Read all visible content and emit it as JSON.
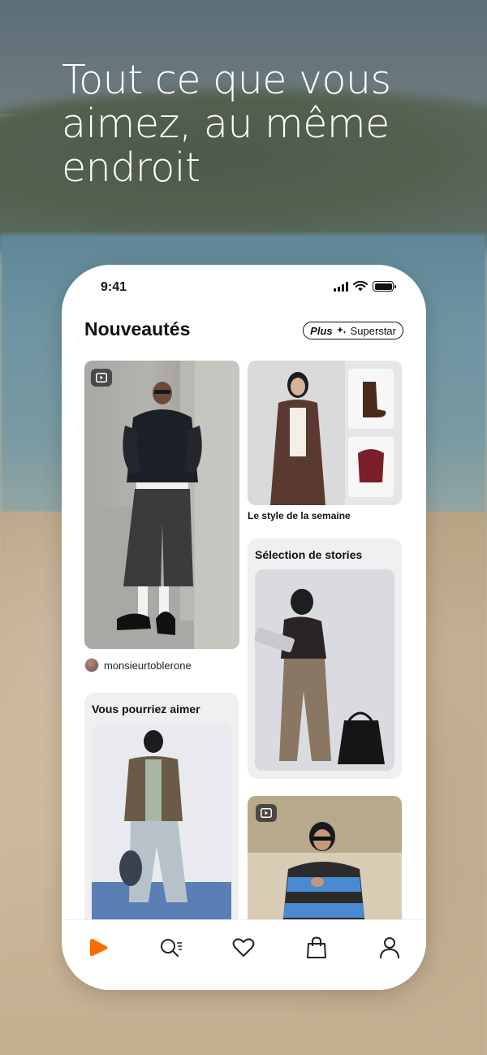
{
  "headline": "Tout ce que vous aimez, au même endroit",
  "status_bar": {
    "time": "9:41"
  },
  "header": {
    "title": "Nouveautés",
    "plus_badge": {
      "plus": "Plus",
      "label": "Superstar"
    }
  },
  "feed": {
    "creator_post": {
      "username": "monsieurtoblerone"
    },
    "style_of_week": {
      "caption": "Le style de la semaine"
    },
    "stories": {
      "title": "Sélection de stories"
    },
    "recommendations": {
      "title": "Vous pourriez aimer"
    }
  },
  "nav": {
    "items": [
      "home-icon",
      "search-icon",
      "heart-icon",
      "bag-icon",
      "profile-icon"
    ],
    "active": "home-icon"
  },
  "colors": {
    "accent": "#ff6900",
    "text": "#111111",
    "card_bg": "#efefef"
  }
}
